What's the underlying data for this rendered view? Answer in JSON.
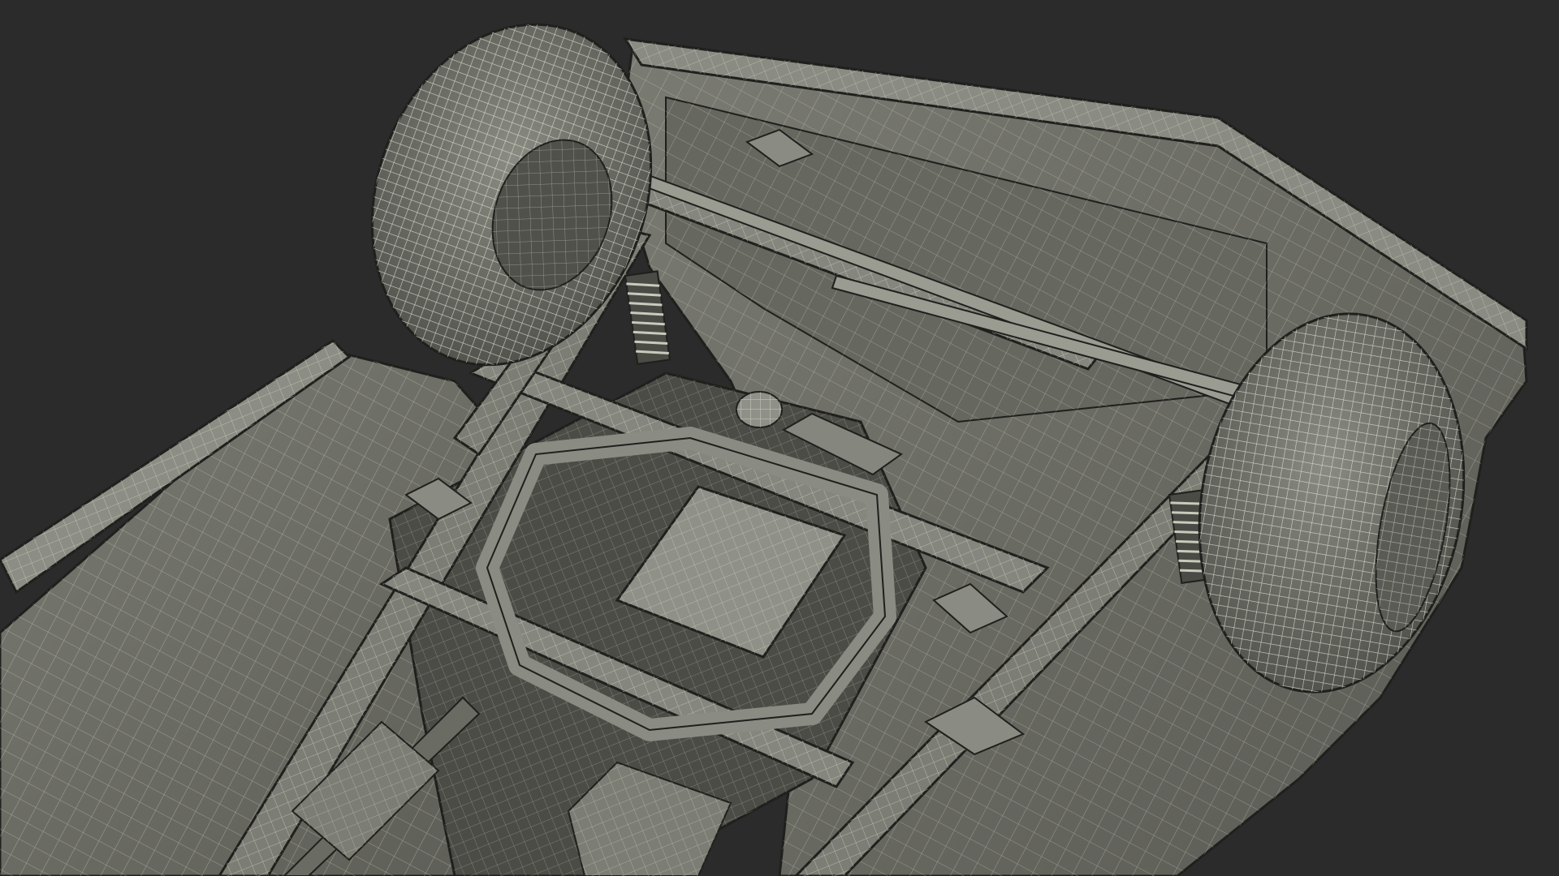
{
  "image": {
    "subject": "",
    "background_color": "#2b2b2b",
    "mesh_fill_color": "#6f7068",
    "mesh_shade_color": "#55564f",
    "mesh_dark_color": "#3b3c37",
    "wire_color": "#d8dacb",
    "edge_color": "#1f201d",
    "labels": []
  }
}
